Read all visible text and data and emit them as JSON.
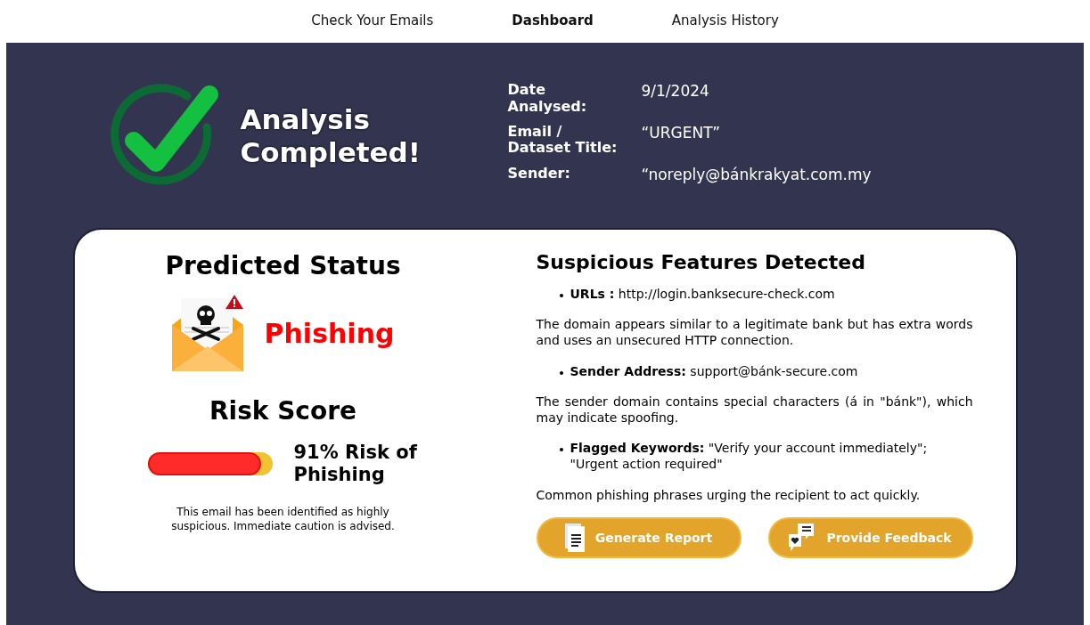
{
  "nav": [
    {
      "label": "Check Your Emails",
      "selected": false
    },
    {
      "label": "Dashboard",
      "selected": true
    },
    {
      "label": "Analysis History",
      "selected": false
    }
  ],
  "header": {
    "title": "Analysis Completed!",
    "details": [
      {
        "label": "Date Analysed:",
        "value": "9/1/2024"
      },
      {
        "label": "Email / Dataset Title:",
        "value": "“URGENT”"
      },
      {
        "label": "Sender:",
        "value": "“noreply@bánkrakyat.com.my"
      }
    ]
  },
  "status": {
    "heading": "Predicted Status",
    "label": "Phishing"
  },
  "risk": {
    "heading": "Risk Score",
    "level": 0.91,
    "reading": "91% Risk of Phishing",
    "note": "This email has been identified as highly suspicious. Immediate caution is advised."
  },
  "features": {
    "heading": "Suspicious Features Detected",
    "items": [
      {
        "kind": "bullet",
        "text": "**URLs :** http://login.banksecure-check.com"
      },
      {
        "kind": "note",
        "text": "The domain appears similar to a legitimate bank but has extra words and uses an unsecured HTTP connection."
      },
      {
        "kind": "bullet",
        "text": "**Sender Address:** support@bánk-secure.com"
      },
      {
        "kind": "note",
        "text": "The sender domain contains special characters (á in \"bánk\"), which may indicate spoofing."
      },
      {
        "kind": "bullet",
        "text": "**Flagged Keywords:** \"Verify your account immediately\"; \"Urgent action required\""
      },
      {
        "kind": "note",
        "text": "Common phishing phrases urging the recipient to act quickly."
      }
    ]
  },
  "buttons": [
    {
      "kind": "report",
      "label": "Generate Report"
    },
    {
      "kind": "feedback",
      "label": "Provide Feedback"
    }
  ]
}
